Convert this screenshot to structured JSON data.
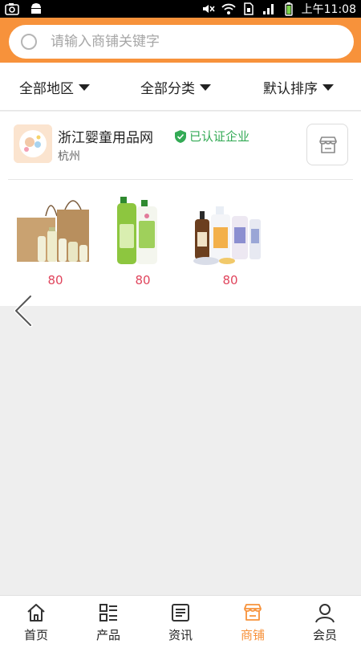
{
  "status_bar": {
    "time": "上午11:08"
  },
  "search": {
    "placeholder": "请输入商铺关键字"
  },
  "filters": [
    {
      "label": "全部地区"
    },
    {
      "label": "全部分类"
    },
    {
      "label": "默认排序"
    }
  ],
  "shop": {
    "name": "浙江婴童用品网",
    "verified_label": "已认证企业",
    "city": "杭州",
    "products": [
      {
        "price": "80"
      },
      {
        "price": "80"
      },
      {
        "price": "80"
      }
    ]
  },
  "tabs": [
    {
      "label": "首页",
      "icon": "home-icon",
      "active": false
    },
    {
      "label": "产品",
      "icon": "product-grid-icon",
      "active": false
    },
    {
      "label": "资讯",
      "icon": "news-icon",
      "active": false
    },
    {
      "label": "商铺",
      "icon": "shop-icon",
      "active": true
    },
    {
      "label": "会员",
      "icon": "member-icon",
      "active": false
    }
  ],
  "colors": {
    "accent": "#f7923b",
    "price": "#e0455d",
    "verified": "#33aa55"
  }
}
